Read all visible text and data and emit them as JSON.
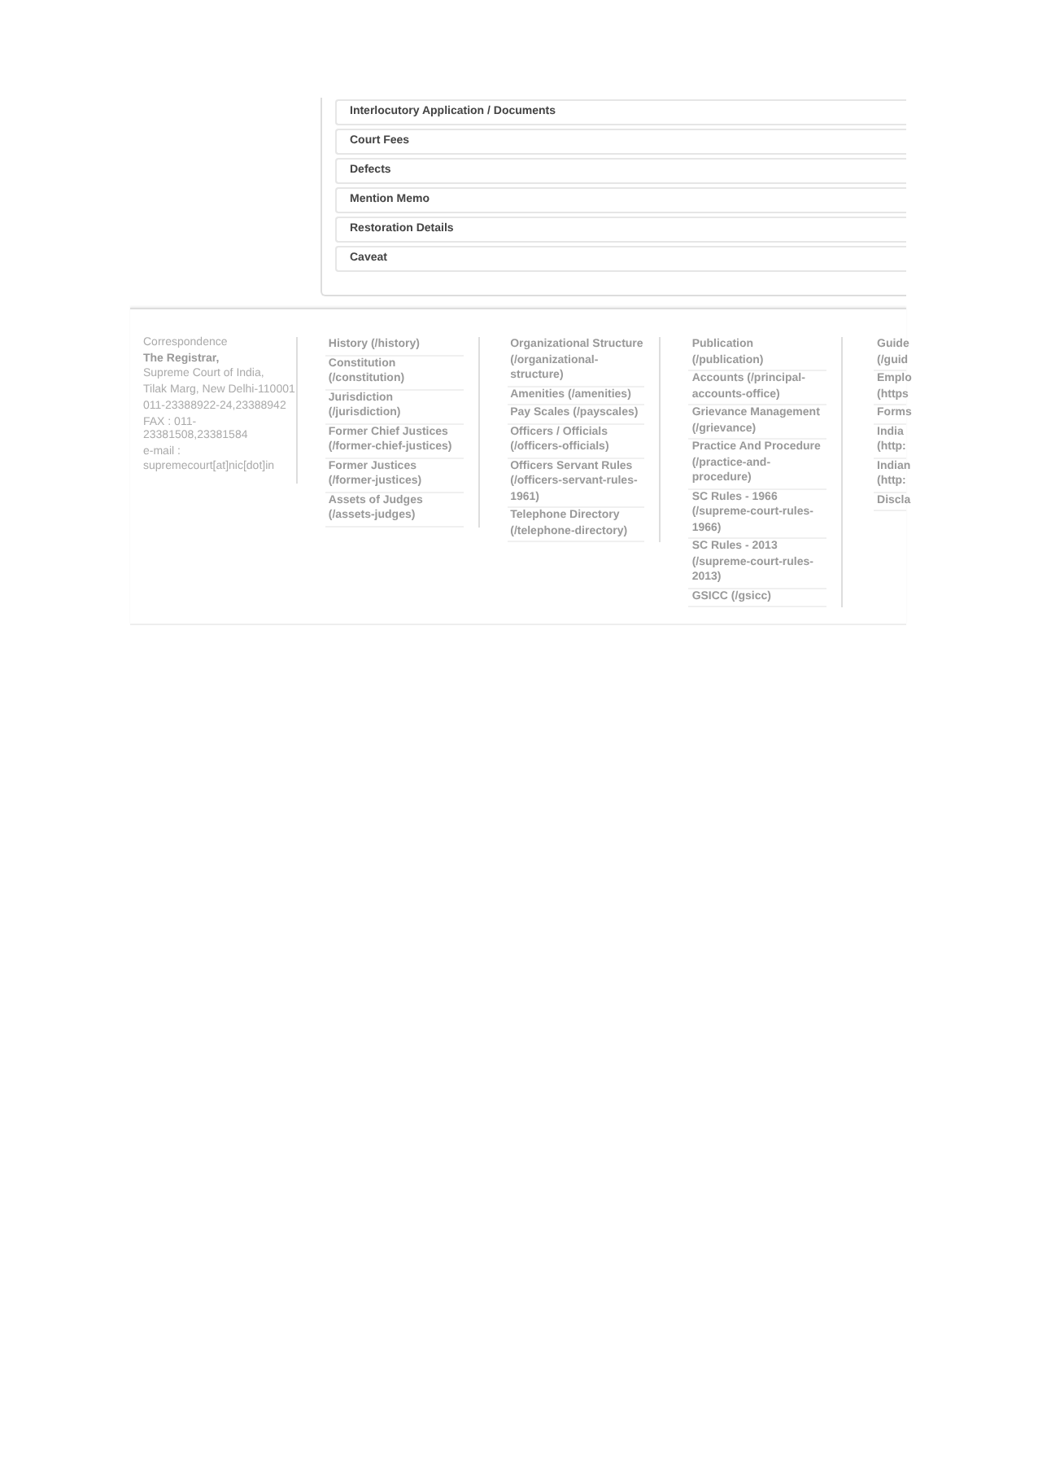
{
  "menu_items": [
    {
      "label": "Interlocutory Application / Documents"
    },
    {
      "label": "Court Fees"
    },
    {
      "label": "Defects"
    },
    {
      "label": "Mention Memo"
    },
    {
      "label": "Restoration Details"
    },
    {
      "label": "Caveat"
    }
  ],
  "footer": {
    "contact": [
      {
        "kind": "label",
        "text": "Correspondence"
      },
      {
        "kind": "name",
        "text": "The Registrar,"
      },
      {
        "kind": "line",
        "text": "Supreme Court of India,"
      },
      {
        "kind": "line",
        "text": "Tilak Marg, New Delhi-110001"
      },
      {
        "kind": "line",
        "text": "011-23388922-24,23388942"
      },
      {
        "kind": "line",
        "text": "FAX : 011-\n23381508,23381584"
      },
      {
        "kind": "line",
        "text": "e-mail :\nsupremecourt[at]nic[dot]in"
      }
    ],
    "link_columns": [
      {
        "links": [
          "History (/history)",
          "Constitution\n(/constitution)",
          "Jurisdiction\n(/jurisdiction)",
          "Former Chief Justices\n(/former-chief-justices)",
          "Former Justices\n(/former-justices)",
          "Assets of Judges\n(/assets-judges)"
        ]
      },
      {
        "links": [
          "Organizational Structure\n(/organizational-\nstructure)",
          "Amenities (/amenities)",
          "Pay Scales (/payscales)",
          "Officers / Officials\n(/officers-officials)",
          "Officers Servant Rules\n(/officers-servant-rules-\n1961)",
          "Telephone Directory\n(/telephone-directory)"
        ]
      },
      {
        "links": [
          "Publication\n(/publication)",
          "Accounts (/principal-\naccounts-office)",
          "Grievance Management\n(/grievance)",
          "Practice And Procedure\n(/practice-and-\nprocedure)",
          "SC Rules - 1966\n(/supreme-court-rules-\n1966)",
          "SC Rules - 2013\n(/supreme-court-rules-\n2013)",
          "GSICC (/gsicc)"
        ]
      },
      {
        "links": [
          "Guide\n(/guid",
          "Emplo\n(https",
          "Forms",
          "India\n(http:",
          "Indian\n(http:",
          "Discla"
        ]
      }
    ]
  }
}
